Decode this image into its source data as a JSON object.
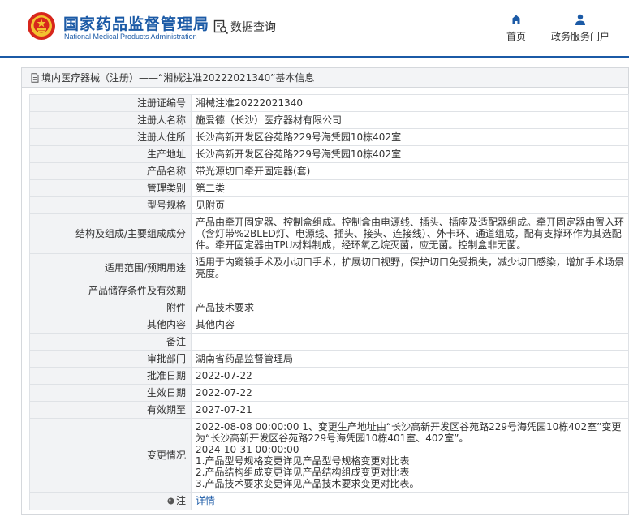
{
  "header": {
    "brand_title": "国家药品监督管理局",
    "brand_subtitle": "National Medical Products Administration",
    "query_label": "数据查询",
    "nav": {
      "home": "首页",
      "portal": "政务服务门户"
    },
    "colors": {
      "brand": "#1b5aa6",
      "emblem_red": "#d7261c",
      "emblem_gold": "#f2c230"
    }
  },
  "panel": {
    "title": "境内医疗器械（注册）——“湘械注准20222021340”基本信息"
  },
  "fields": [
    {
      "label": "注册证编号",
      "value": "湘械注准20222021340"
    },
    {
      "label": "注册人名称",
      "value": "施爱德（长沙）医疗器材有限公司"
    },
    {
      "label": "注册人住所",
      "value": "长沙高新开发区谷苑路229号海凭园10栋402室"
    },
    {
      "label": "生产地址",
      "value": "长沙高新开发区谷苑路229号海凭园10栋402室"
    },
    {
      "label": "产品名称",
      "value": "带光源切口牵开固定器(套)"
    },
    {
      "label": "管理类别",
      "value": "第二类"
    },
    {
      "label": "型号规格",
      "value": "见附页"
    },
    {
      "label": "结构及组成/主要组成成分",
      "value": "产品由牵开固定器、控制盒组成。控制盒由电源线、插头、插座及适配器组成。牵开固定器由置入环（含灯带%2BLED灯、电源线、插头、接头、连接线）、外卡环、通道组成，配有支撑环作为其选配件。牵开固定器由TPU材料制成，经环氧乙烷灭菌，应无菌。控制盒非无菌。"
    },
    {
      "label": "适用范围/预期用途",
      "value": "适用于内窥镜手术及小切口手术，扩展切口视野，保护切口免受损失，减少切口感染，增加手术场景亮度。"
    },
    {
      "label": "产品储存条件及有效期",
      "value": ""
    },
    {
      "label": "附件",
      "value": "产品技术要求"
    },
    {
      "label": "其他内容",
      "value": "其他内容"
    },
    {
      "label": "备注",
      "value": ""
    },
    {
      "label": "审批部门",
      "value": "湖南省药品监督管理局"
    },
    {
      "label": "批准日期",
      "value": "2022-07-22"
    },
    {
      "label": "生效日期",
      "value": "2022-07-22"
    },
    {
      "label": "有效期至",
      "value": "2027-07-21"
    }
  ],
  "change": {
    "label": "变更情况",
    "lines": [
      "2022-08-08 00:00:00 1、变更生产地址由“长沙高新开发区谷苑路229号海凭园10栋402室”变更为“长沙高新开发区谷苑路229号海凭园10栋401室、402室”。",
      "2024-10-31 00:00:00",
      "1.产品型号规格变更详见产品型号规格变更对比表",
      "2.产品结构组成变更详见产品结构组成变更对比表",
      "3.产品技术要求变更详见产品技术要求变更对比表。"
    ]
  },
  "note": {
    "label": "注",
    "link": "详情",
    "icon": "info-dot-icon"
  }
}
